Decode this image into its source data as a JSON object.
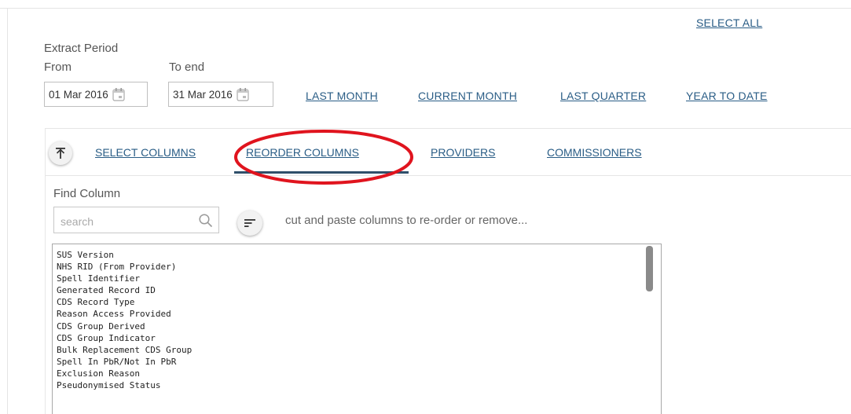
{
  "header": {
    "select_all": "SELECT ALL"
  },
  "extract_period": {
    "title": "Extract Period",
    "from_label": "From",
    "to_label": "To end",
    "from_value": "01 Mar 2016",
    "to_value": "31 Mar 2016"
  },
  "quick_ranges": [
    "LAST MONTH",
    "CURRENT MONTH",
    "LAST QUARTER",
    "YEAR TO DATE"
  ],
  "tabs": [
    {
      "label": "SELECT COLUMNS",
      "active": false
    },
    {
      "label": "REORDER COLUMNS",
      "active": true
    },
    {
      "label": "PROVIDERS",
      "active": false
    },
    {
      "label": "COMMISSIONERS",
      "active": false
    }
  ],
  "find_column": {
    "label": "Find Column",
    "placeholder": "search",
    "hint": "cut and paste columns to re-order or remove..."
  },
  "columns": [
    "SUS Version",
    "NHS RID (From Provider)",
    "Spell Identifier",
    "Generated Record ID",
    "CDS Record Type",
    "Reason Access Provided",
    "CDS Group Derived",
    "CDS Group Indicator",
    "Bulk Replacement CDS Group",
    "Spell In PbR/Not In PbR",
    "Exclusion Reason",
    "Pseudonymised Status"
  ],
  "colors": {
    "link": "#2a5d86",
    "highlight": "#e0141e",
    "active_tab_underline": "#2f4f6a"
  },
  "icons": {
    "calendar": "calendar-icon",
    "collapse": "collapse-up-icon",
    "search": "search-icon",
    "sort": "sort-icon"
  }
}
